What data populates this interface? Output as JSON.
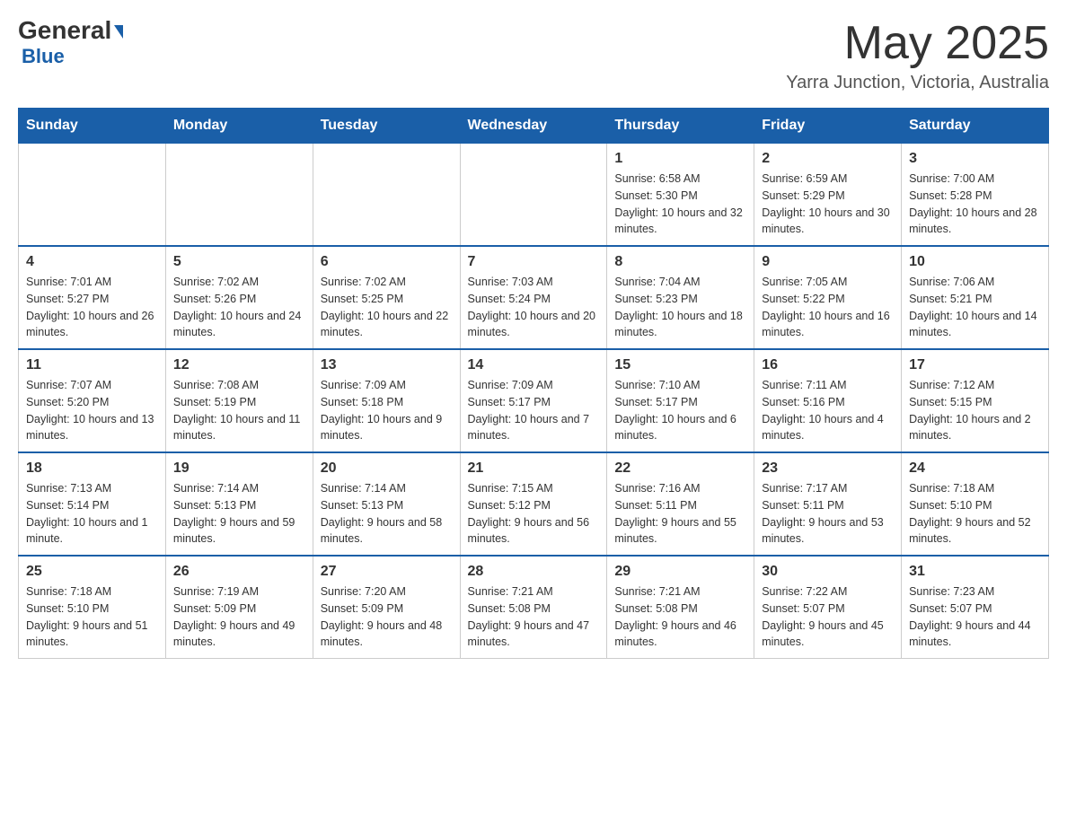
{
  "header": {
    "logo_general": "General",
    "logo_blue": "Blue",
    "month_title": "May 2025",
    "location": "Yarra Junction, Victoria, Australia"
  },
  "weekdays": [
    "Sunday",
    "Monday",
    "Tuesday",
    "Wednesday",
    "Thursday",
    "Friday",
    "Saturday"
  ],
  "weeks": [
    [
      {
        "day": "",
        "info": ""
      },
      {
        "day": "",
        "info": ""
      },
      {
        "day": "",
        "info": ""
      },
      {
        "day": "",
        "info": ""
      },
      {
        "day": "1",
        "info": "Sunrise: 6:58 AM\nSunset: 5:30 PM\nDaylight: 10 hours and 32 minutes."
      },
      {
        "day": "2",
        "info": "Sunrise: 6:59 AM\nSunset: 5:29 PM\nDaylight: 10 hours and 30 minutes."
      },
      {
        "day": "3",
        "info": "Sunrise: 7:00 AM\nSunset: 5:28 PM\nDaylight: 10 hours and 28 minutes."
      }
    ],
    [
      {
        "day": "4",
        "info": "Sunrise: 7:01 AM\nSunset: 5:27 PM\nDaylight: 10 hours and 26 minutes."
      },
      {
        "day": "5",
        "info": "Sunrise: 7:02 AM\nSunset: 5:26 PM\nDaylight: 10 hours and 24 minutes."
      },
      {
        "day": "6",
        "info": "Sunrise: 7:02 AM\nSunset: 5:25 PM\nDaylight: 10 hours and 22 minutes."
      },
      {
        "day": "7",
        "info": "Sunrise: 7:03 AM\nSunset: 5:24 PM\nDaylight: 10 hours and 20 minutes."
      },
      {
        "day": "8",
        "info": "Sunrise: 7:04 AM\nSunset: 5:23 PM\nDaylight: 10 hours and 18 minutes."
      },
      {
        "day": "9",
        "info": "Sunrise: 7:05 AM\nSunset: 5:22 PM\nDaylight: 10 hours and 16 minutes."
      },
      {
        "day": "10",
        "info": "Sunrise: 7:06 AM\nSunset: 5:21 PM\nDaylight: 10 hours and 14 minutes."
      }
    ],
    [
      {
        "day": "11",
        "info": "Sunrise: 7:07 AM\nSunset: 5:20 PM\nDaylight: 10 hours and 13 minutes."
      },
      {
        "day": "12",
        "info": "Sunrise: 7:08 AM\nSunset: 5:19 PM\nDaylight: 10 hours and 11 minutes."
      },
      {
        "day": "13",
        "info": "Sunrise: 7:09 AM\nSunset: 5:18 PM\nDaylight: 10 hours and 9 minutes."
      },
      {
        "day": "14",
        "info": "Sunrise: 7:09 AM\nSunset: 5:17 PM\nDaylight: 10 hours and 7 minutes."
      },
      {
        "day": "15",
        "info": "Sunrise: 7:10 AM\nSunset: 5:17 PM\nDaylight: 10 hours and 6 minutes."
      },
      {
        "day": "16",
        "info": "Sunrise: 7:11 AM\nSunset: 5:16 PM\nDaylight: 10 hours and 4 minutes."
      },
      {
        "day": "17",
        "info": "Sunrise: 7:12 AM\nSunset: 5:15 PM\nDaylight: 10 hours and 2 minutes."
      }
    ],
    [
      {
        "day": "18",
        "info": "Sunrise: 7:13 AM\nSunset: 5:14 PM\nDaylight: 10 hours and 1 minute."
      },
      {
        "day": "19",
        "info": "Sunrise: 7:14 AM\nSunset: 5:13 PM\nDaylight: 9 hours and 59 minutes."
      },
      {
        "day": "20",
        "info": "Sunrise: 7:14 AM\nSunset: 5:13 PM\nDaylight: 9 hours and 58 minutes."
      },
      {
        "day": "21",
        "info": "Sunrise: 7:15 AM\nSunset: 5:12 PM\nDaylight: 9 hours and 56 minutes."
      },
      {
        "day": "22",
        "info": "Sunrise: 7:16 AM\nSunset: 5:11 PM\nDaylight: 9 hours and 55 minutes."
      },
      {
        "day": "23",
        "info": "Sunrise: 7:17 AM\nSunset: 5:11 PM\nDaylight: 9 hours and 53 minutes."
      },
      {
        "day": "24",
        "info": "Sunrise: 7:18 AM\nSunset: 5:10 PM\nDaylight: 9 hours and 52 minutes."
      }
    ],
    [
      {
        "day": "25",
        "info": "Sunrise: 7:18 AM\nSunset: 5:10 PM\nDaylight: 9 hours and 51 minutes."
      },
      {
        "day": "26",
        "info": "Sunrise: 7:19 AM\nSunset: 5:09 PM\nDaylight: 9 hours and 49 minutes."
      },
      {
        "day": "27",
        "info": "Sunrise: 7:20 AM\nSunset: 5:09 PM\nDaylight: 9 hours and 48 minutes."
      },
      {
        "day": "28",
        "info": "Sunrise: 7:21 AM\nSunset: 5:08 PM\nDaylight: 9 hours and 47 minutes."
      },
      {
        "day": "29",
        "info": "Sunrise: 7:21 AM\nSunset: 5:08 PM\nDaylight: 9 hours and 46 minutes."
      },
      {
        "day": "30",
        "info": "Sunrise: 7:22 AM\nSunset: 5:07 PM\nDaylight: 9 hours and 45 minutes."
      },
      {
        "day": "31",
        "info": "Sunrise: 7:23 AM\nSunset: 5:07 PM\nDaylight: 9 hours and 44 minutes."
      }
    ]
  ]
}
